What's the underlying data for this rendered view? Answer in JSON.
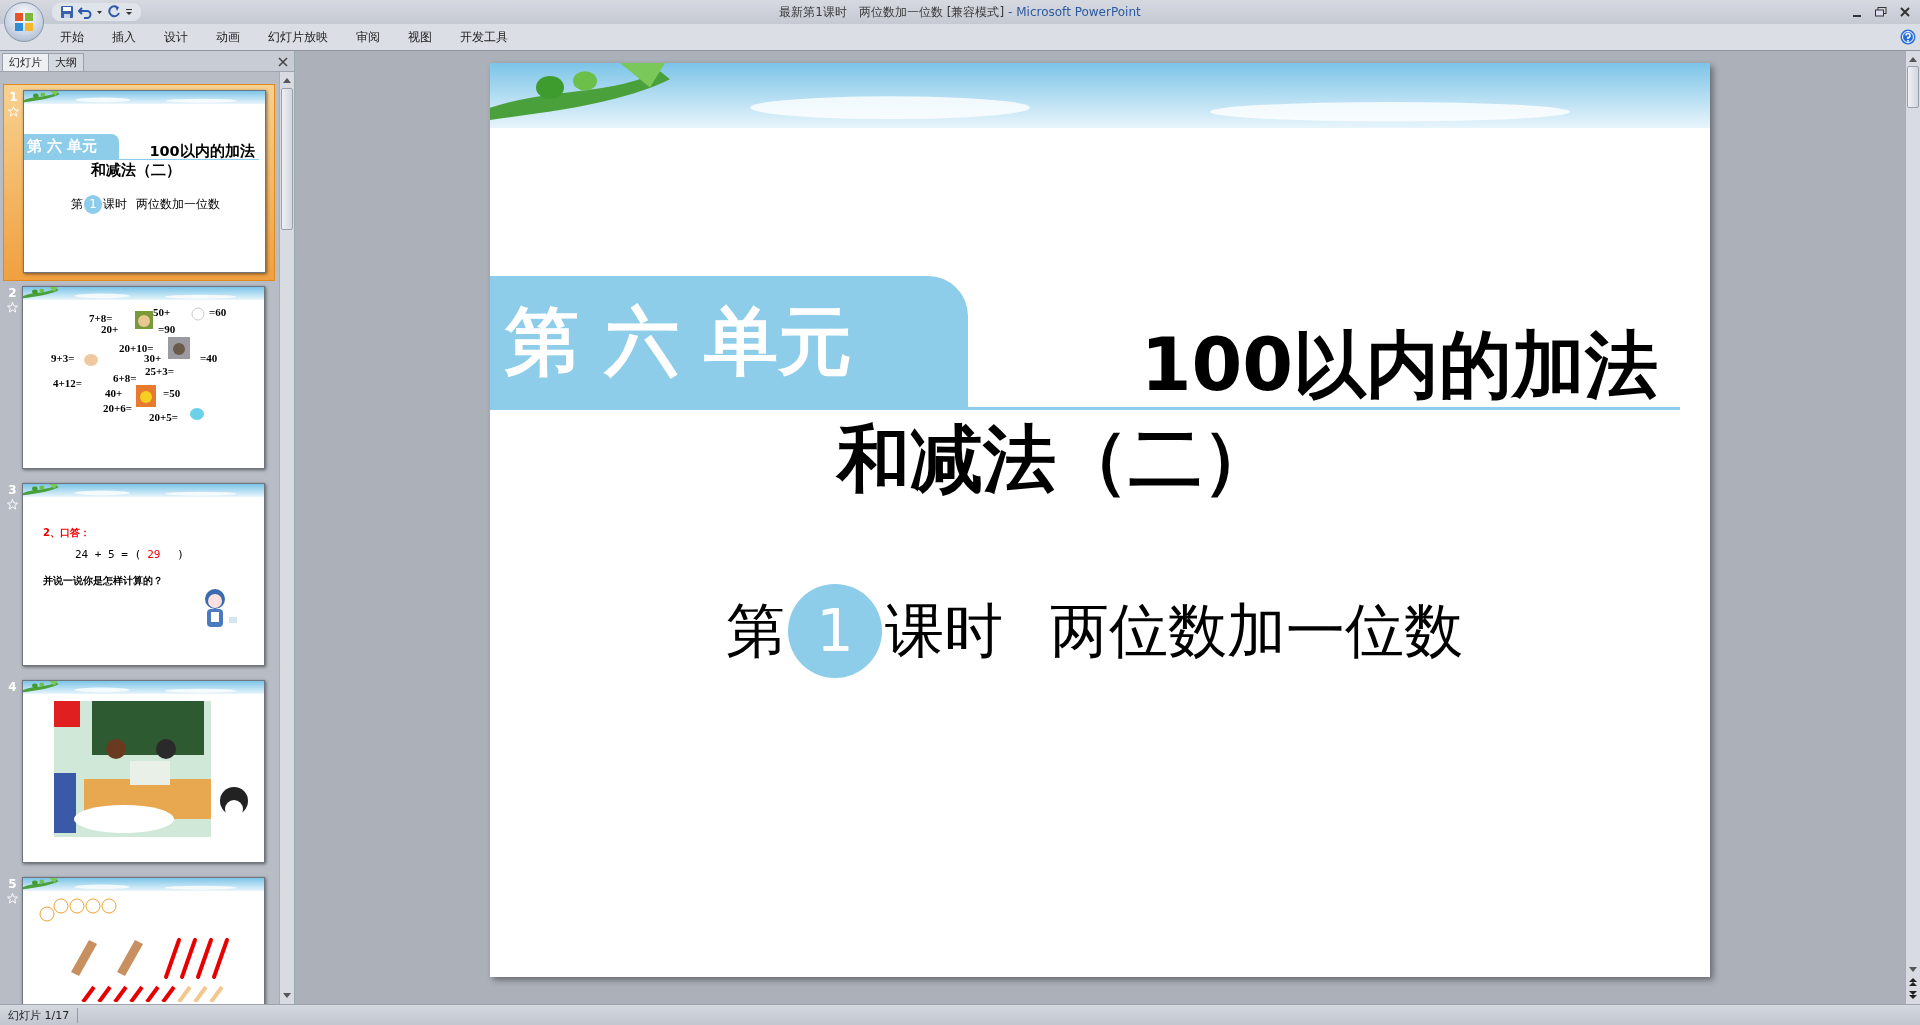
{
  "window": {
    "document": "最新第1课时　两位数加一位数 [兼容模式]",
    "app": "- Microsoft PowerPoint"
  },
  "ribbon_tabs": [
    {
      "label": "开始",
      "selected": false
    },
    {
      "label": "插入",
      "selected": false
    },
    {
      "label": "设计",
      "selected": false
    },
    {
      "label": "动画",
      "selected": false
    },
    {
      "label": "幻灯片放映",
      "selected": false
    },
    {
      "label": "审阅",
      "selected": false
    },
    {
      "label": "视图",
      "selected": false
    },
    {
      "label": "开发工具",
      "selected": false
    }
  ],
  "pane_tabs": [
    {
      "label": "幻灯片",
      "selected": true
    },
    {
      "label": "大纲",
      "selected": false
    }
  ],
  "slides": [
    {
      "number": "1",
      "selected": true,
      "has_animation": true,
      "kind": "title",
      "unit": "第 六 单元",
      "title_line1": "100以内的加法",
      "title_line2": "和减法（二）",
      "lesson_prefix": "第",
      "lesson_number": "1",
      "lesson_suffix": "课时",
      "lesson_topic": "两位数加一位数"
    },
    {
      "number": "2",
      "selected": false,
      "has_animation": true,
      "kind": "equations",
      "equations": [
        "7+8=",
        "50+",
        "=60",
        "20+",
        "=90",
        "20+10=",
        "9+3=",
        "30+",
        "=40",
        "25+3=",
        "4+12=",
        "6+8=",
        "40+",
        "=50",
        "20+6=",
        "20+5="
      ]
    },
    {
      "number": "3",
      "selected": false,
      "has_animation": true,
      "kind": "question",
      "heading": "2、口答：",
      "expression": "24 + 5 = (",
      "answer": "29",
      "closing": ")",
      "prompt": "并说一说你是怎样计算的？"
    },
    {
      "number": "4",
      "selected": false,
      "has_animation": false,
      "kind": "picture"
    },
    {
      "number": "5",
      "selected": false,
      "has_animation": true,
      "kind": "sticks"
    }
  ],
  "editor": {
    "slide": {
      "unit": "第 六 单元",
      "title_line1": "100以内的加法",
      "title_line2": "和减法（二）",
      "lesson_prefix": "第",
      "lesson_number": "1",
      "lesson_suffix": "课时",
      "lesson_topic": "两位数加一位数"
    }
  },
  "status_bar": {
    "slide_counter": "幻灯片 1/17"
  }
}
